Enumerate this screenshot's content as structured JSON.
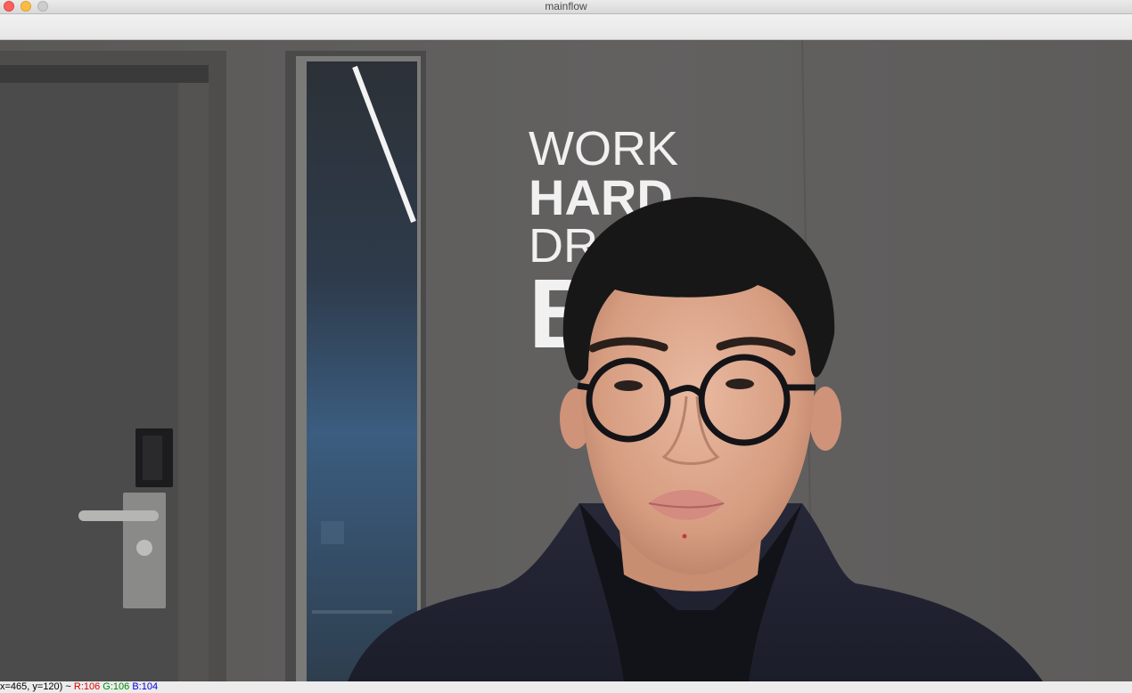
{
  "window": {
    "title": "mainflow",
    "buttons": {
      "close": "close-button",
      "minimize": "minimize-button",
      "zoom": "zoom-button"
    }
  },
  "poster": {
    "line1": "WORK",
    "line2": "HARD",
    "line3": "DR",
    "line4": "B"
  },
  "status": {
    "coords": "x=465, y=120) ~",
    "r": "R:106",
    "g": "G:106",
    "b": "B:104"
  },
  "colors": {
    "close": "#fc605c",
    "minimize": "#fdbc40",
    "zoom": "#cdcdcd",
    "r_label": "#e00000",
    "g_label": "#008a00",
    "b_label": "#0000e0"
  }
}
